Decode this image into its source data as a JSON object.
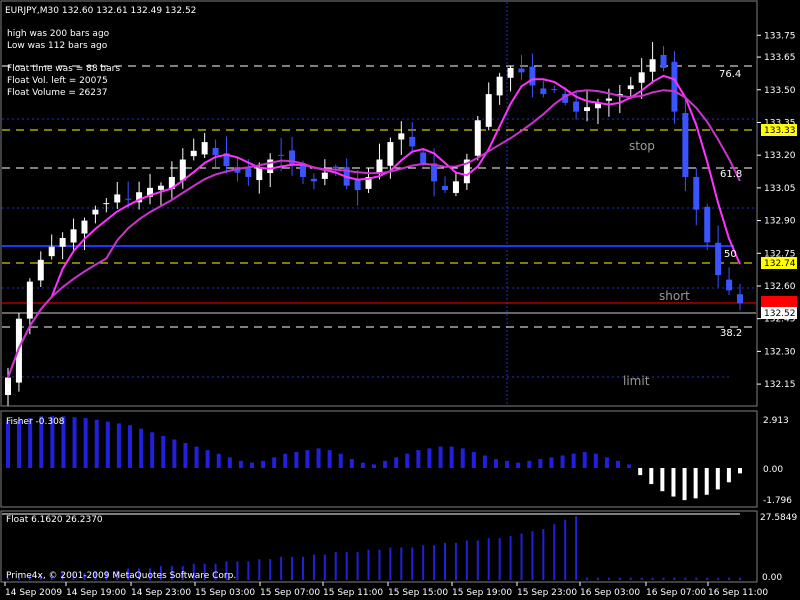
{
  "header": {
    "symbol_line": "EURJPY,M30  132.60 132.61 132.49 132.52",
    "high_was": "high was   200  bars ago",
    "low_was": "Low was    112 bars ago",
    "float_time": "Float time was  =     88 bars",
    "float_vol_left": "Float Vol. left    =     20075",
    "float_volume": "Float Volume     =     26237"
  },
  "price_axis": {
    "ticks": [
      "133.75",
      "133.65",
      "133.50",
      "133.35",
      "133.20",
      "133.05",
      "132.90",
      "132.75",
      "132.60",
      "132.45",
      "132.30",
      "132.15"
    ],
    "tags": [
      {
        "text": "133.33",
        "bg": "#ffff00",
        "fg": "#000000"
      },
      {
        "text": "132.74",
        "bg": "#ffff00",
        "fg": "#000000"
      },
      {
        "text": "132.58",
        "bg": "#ff0000",
        "fg": "#ff0000"
      },
      {
        "text": "132.52",
        "bg": "#ffffff",
        "fg": "#000000"
      }
    ]
  },
  "annotations": {
    "fib_76": "76.4",
    "fib_61": "61.8",
    "fib_50": "50",
    "fib_38": "38.2",
    "stop": "stop",
    "short": "short",
    "limit": "limit"
  },
  "fisher": {
    "label": "Fisher -0.308",
    "ticks": [
      "2.913",
      "0.00",
      "-1.796"
    ]
  },
  "float_panel": {
    "label": "Float 6.1620 26.2370",
    "ticks": [
      "27.5849",
      "0.00"
    ],
    "copyright": "Prime4x, © 2001-2009 MetaQuotes Software Corp."
  },
  "time_axis": [
    "14 Sep 2009",
    "14 Sep 19:00",
    "14 Sep 23:00",
    "15 Sep 03:00",
    "15 Sep 07:00",
    "15 Sep 11:00",
    "15 Sep 15:00",
    "15 Sep 19:00",
    "15 Sep 23:00",
    "16 Sep 03:00",
    "16 Sep 07:00",
    "16 Sep 11:00"
  ],
  "colors": {
    "background": "#000000",
    "bull_candle": "#ffffff",
    "bear_candle": "#3a55ff",
    "ma_fast": "#ff33ff",
    "ma_slow": "#cc33cc",
    "fisher_pos": "#2020dd",
    "fisher_neg": "#ffffff",
    "level_blue": "#2233ff",
    "level_red": "#ff0000",
    "level_yellow": "#ffff00",
    "grid_blue": "#2233cc",
    "label_gray": "#9a9a9a"
  },
  "chart_data": {
    "type": "candlestick",
    "symbol": "EURJPY",
    "timeframe": "M30",
    "ohlc_last": {
      "open": 132.6,
      "high": 132.61,
      "low": 132.49,
      "close": 132.52
    },
    "ylim": [
      132.1,
      133.82
    ],
    "levels": [
      {
        "price": 133.33,
        "color": "#ffff00",
        "style": "dashed",
        "label": "stop"
      },
      {
        "price": 132.8,
        "color": "#2233ff",
        "style": "solid"
      },
      {
        "price": 132.74,
        "color": "#ffff00",
        "style": "dashed"
      },
      {
        "price": 132.58,
        "color": "#ff0000",
        "style": "solid",
        "label": "short"
      },
      {
        "price": 132.52,
        "color": "#ffffff",
        "style": "solid"
      },
      {
        "price": 132.26,
        "color": "#2233cc",
        "style": "dotted",
        "label": "limit"
      }
    ],
    "fib_levels": [
      {
        "label": "76.4",
        "price": 133.62
      },
      {
        "label": "61.8",
        "price": 133.17
      },
      {
        "label": "50",
        "price": 132.8
      },
      {
        "label": "38.2",
        "price": 132.47
      }
    ],
    "close_path": [
      132.18,
      132.45,
      132.62,
      132.72,
      132.78,
      132.82,
      132.86,
      132.9,
      132.95,
      132.98,
      133.02,
      133.0,
      133.03,
      133.05,
      133.06,
      133.1,
      133.18,
      133.22,
      133.26,
      133.2,
      133.15,
      133.12,
      133.1,
      133.14,
      133.18,
      133.2,
      133.16,
      133.1,
      133.08,
      133.12,
      133.14,
      133.06,
      133.04,
      133.1,
      133.18,
      133.26,
      133.3,
      133.24,
      133.16,
      133.08,
      133.04,
      133.08,
      133.18,
      133.36,
      133.48,
      133.56,
      133.6,
      133.58,
      133.52,
      133.48,
      133.5,
      133.44,
      133.4,
      133.42,
      133.44,
      133.46,
      133.48,
      133.52,
      133.58,
      133.64,
      133.6,
      133.4,
      133.1,
      132.95,
      132.8,
      132.65,
      132.58,
      132.52
    ],
    "fisher_values": [
      2.6,
      2.7,
      2.8,
      2.9,
      2.9,
      2.9,
      2.85,
      2.8,
      2.7,
      2.6,
      2.5,
      2.4,
      2.2,
      2.0,
      1.8,
      1.6,
      1.4,
      1.2,
      1.0,
      0.8,
      0.6,
      0.4,
      0.3,
      0.4,
      0.6,
      0.8,
      0.9,
      1.0,
      1.1,
      1.0,
      0.8,
      0.5,
      0.3,
      0.2,
      0.4,
      0.6,
      0.8,
      1.0,
      1.1,
      1.2,
      1.2,
      1.1,
      0.9,
      0.7,
      0.5,
      0.4,
      0.3,
      0.4,
      0.5,
      0.6,
      0.7,
      0.8,
      0.9,
      0.8,
      0.6,
      0.4,
      0.2,
      -0.4,
      -0.9,
      -1.3,
      -1.6,
      -1.8,
      -1.7,
      -1.5,
      -1.2,
      -0.8,
      -0.3
    ],
    "float_values": [
      1,
      1,
      2,
      2,
      2,
      3,
      3,
      3,
      4,
      4,
      4,
      5,
      5,
      5,
      6,
      6,
      6,
      7,
      7,
      7,
      8,
      8,
      8,
      9,
      9,
      10,
      10,
      10,
      11,
      11,
      12,
      12,
      12,
      13,
      13,
      14,
      14,
      14,
      15,
      15,
      16,
      16,
      17,
      17,
      18,
      18,
      19,
      20,
      21,
      22,
      24,
      26,
      27.5,
      1,
      1,
      1,
      1,
      1,
      1,
      1,
      1,
      1,
      1,
      1,
      1,
      1,
      1,
      1
    ]
  }
}
